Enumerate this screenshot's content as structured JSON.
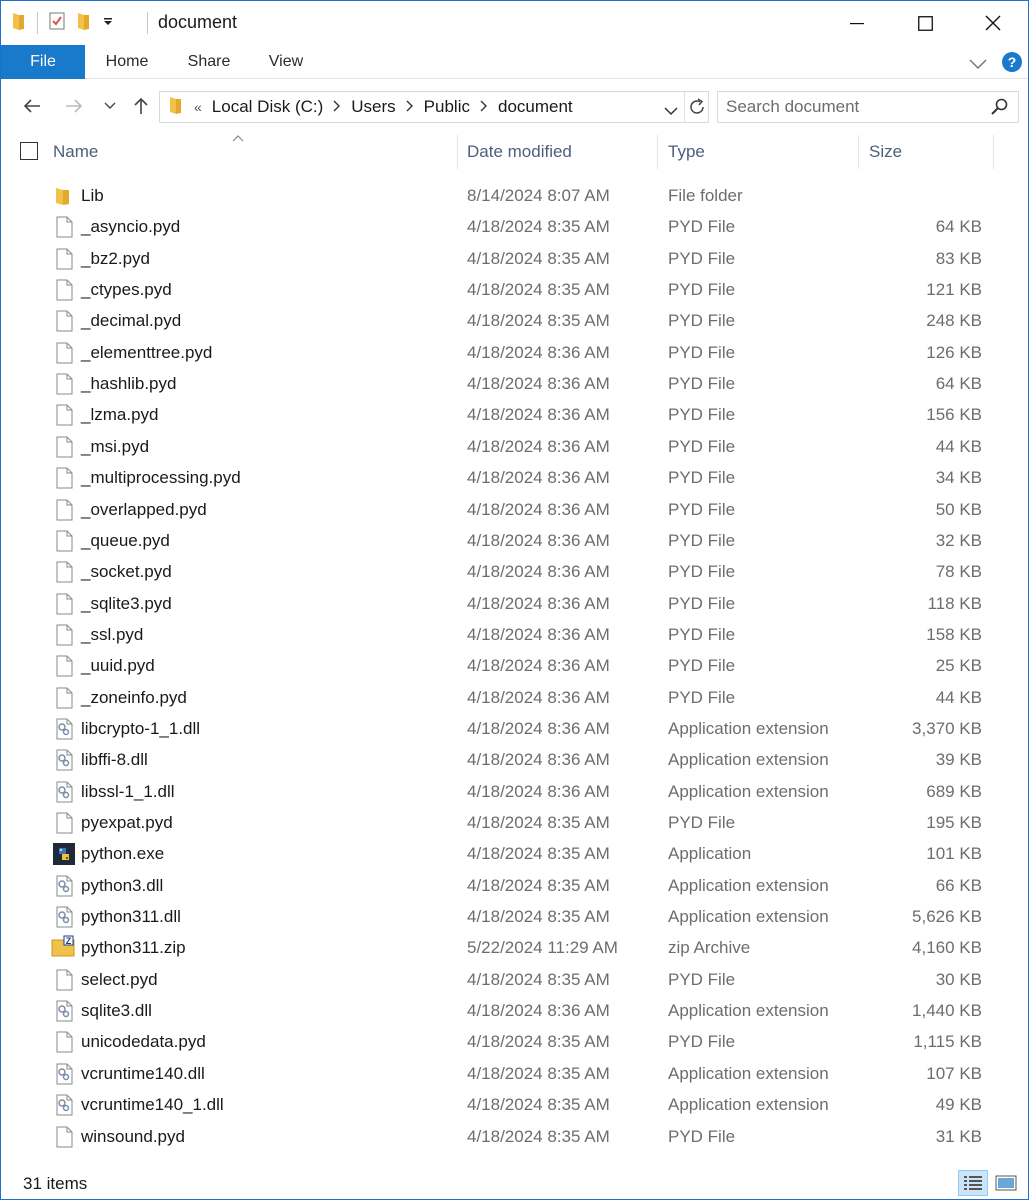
{
  "window": {
    "title": "document",
    "accent_color": "#1979ca"
  },
  "ribbon": {
    "tabs": [
      "File",
      "Home",
      "Share",
      "View"
    ]
  },
  "address": {
    "overflow": "«",
    "crumbs": [
      "Local Disk (C:)",
      "Users",
      "Public",
      "document"
    ]
  },
  "search": {
    "placeholder": "Search document"
  },
  "columns": {
    "name": "Name",
    "date": "Date modified",
    "type": "Type",
    "size": "Size"
  },
  "files": [
    {
      "name": "Lib",
      "date": "8/14/2024 8:07 AM",
      "type": "File folder",
      "size": "",
      "icon": "folder-icon"
    },
    {
      "name": "_asyncio.pyd",
      "date": "4/18/2024 8:35 AM",
      "type": "PYD File",
      "size": "64 KB",
      "icon": "file-icon"
    },
    {
      "name": "_bz2.pyd",
      "date": "4/18/2024 8:35 AM",
      "type": "PYD File",
      "size": "83 KB",
      "icon": "file-icon"
    },
    {
      "name": "_ctypes.pyd",
      "date": "4/18/2024 8:35 AM",
      "type": "PYD File",
      "size": "121 KB",
      "icon": "file-icon"
    },
    {
      "name": "_decimal.pyd",
      "date": "4/18/2024 8:35 AM",
      "type": "PYD File",
      "size": "248 KB",
      "icon": "file-icon"
    },
    {
      "name": "_elementtree.pyd",
      "date": "4/18/2024 8:36 AM",
      "type": "PYD File",
      "size": "126 KB",
      "icon": "file-icon"
    },
    {
      "name": "_hashlib.pyd",
      "date": "4/18/2024 8:36 AM",
      "type": "PYD File",
      "size": "64 KB",
      "icon": "file-icon"
    },
    {
      "name": "_lzma.pyd",
      "date": "4/18/2024 8:36 AM",
      "type": "PYD File",
      "size": "156 KB",
      "icon": "file-icon"
    },
    {
      "name": "_msi.pyd",
      "date": "4/18/2024 8:36 AM",
      "type": "PYD File",
      "size": "44 KB",
      "icon": "file-icon"
    },
    {
      "name": "_multiprocessing.pyd",
      "date": "4/18/2024 8:36 AM",
      "type": "PYD File",
      "size": "34 KB",
      "icon": "file-icon"
    },
    {
      "name": "_overlapped.pyd",
      "date": "4/18/2024 8:36 AM",
      "type": "PYD File",
      "size": "50 KB",
      "icon": "file-icon"
    },
    {
      "name": "_queue.pyd",
      "date": "4/18/2024 8:36 AM",
      "type": "PYD File",
      "size": "32 KB",
      "icon": "file-icon"
    },
    {
      "name": "_socket.pyd",
      "date": "4/18/2024 8:36 AM",
      "type": "PYD File",
      "size": "78 KB",
      "icon": "file-icon"
    },
    {
      "name": "_sqlite3.pyd",
      "date": "4/18/2024 8:36 AM",
      "type": "PYD File",
      "size": "118 KB",
      "icon": "file-icon"
    },
    {
      "name": "_ssl.pyd",
      "date": "4/18/2024 8:36 AM",
      "type": "PYD File",
      "size": "158 KB",
      "icon": "file-icon"
    },
    {
      "name": "_uuid.pyd",
      "date": "4/18/2024 8:36 AM",
      "type": "PYD File",
      "size": "25 KB",
      "icon": "file-icon"
    },
    {
      "name": "_zoneinfo.pyd",
      "date": "4/18/2024 8:36 AM",
      "type": "PYD File",
      "size": "44 KB",
      "icon": "file-icon"
    },
    {
      "name": "libcrypto-1_1.dll",
      "date": "4/18/2024 8:36 AM",
      "type": "Application extension",
      "size": "3,370 KB",
      "icon": "dll-icon"
    },
    {
      "name": "libffi-8.dll",
      "date": "4/18/2024 8:36 AM",
      "type": "Application extension",
      "size": "39 KB",
      "icon": "dll-icon"
    },
    {
      "name": "libssl-1_1.dll",
      "date": "4/18/2024 8:36 AM",
      "type": "Application extension",
      "size": "689 KB",
      "icon": "dll-icon"
    },
    {
      "name": "pyexpat.pyd",
      "date": "4/18/2024 8:35 AM",
      "type": "PYD File",
      "size": "195 KB",
      "icon": "file-icon"
    },
    {
      "name": "python.exe",
      "date": "4/18/2024 8:35 AM",
      "type": "Application",
      "size": "101 KB",
      "icon": "python-icon"
    },
    {
      "name": "python3.dll",
      "date": "4/18/2024 8:35 AM",
      "type": "Application extension",
      "size": "66 KB",
      "icon": "dll-icon"
    },
    {
      "name": "python311.dll",
      "date": "4/18/2024 8:35 AM",
      "type": "Application extension",
      "size": "5,626 KB",
      "icon": "dll-icon"
    },
    {
      "name": "python311.zip",
      "date": "5/22/2024 11:29 AM",
      "type": "zip Archive",
      "size": "4,160 KB",
      "icon": "zip-folder-icon"
    },
    {
      "name": "select.pyd",
      "date": "4/18/2024 8:35 AM",
      "type": "PYD File",
      "size": "30 KB",
      "icon": "file-icon"
    },
    {
      "name": "sqlite3.dll",
      "date": "4/18/2024 8:36 AM",
      "type": "Application extension",
      "size": "1,440 KB",
      "icon": "dll-icon"
    },
    {
      "name": "unicodedata.pyd",
      "date": "4/18/2024 8:35 AM",
      "type": "PYD File",
      "size": "1,115 KB",
      "icon": "file-icon"
    },
    {
      "name": "vcruntime140.dll",
      "date": "4/18/2024 8:35 AM",
      "type": "Application extension",
      "size": "107 KB",
      "icon": "dll-icon"
    },
    {
      "name": "vcruntime140_1.dll",
      "date": "4/18/2024 8:35 AM",
      "type": "Application extension",
      "size": "49 KB",
      "icon": "dll-icon"
    },
    {
      "name": "winsound.pyd",
      "date": "4/18/2024 8:35 AM",
      "type": "PYD File",
      "size": "31 KB",
      "icon": "file-icon"
    }
  ],
  "status": {
    "item_count": "31 items"
  }
}
